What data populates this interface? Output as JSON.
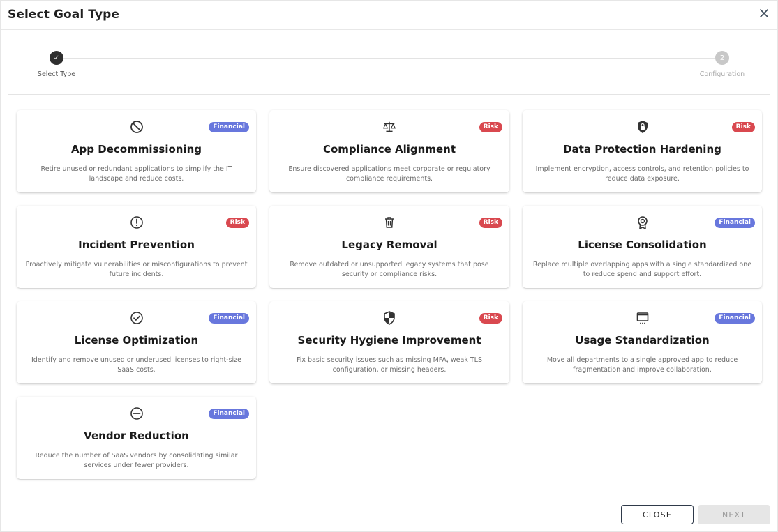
{
  "dialog": {
    "title": "Select Goal Type",
    "close_icon": "close-icon"
  },
  "stepper": {
    "steps": [
      {
        "label": "Select Type",
        "marker": "✓",
        "state": "completed"
      },
      {
        "label": "Configuration",
        "marker": "2",
        "state": "pending"
      }
    ]
  },
  "colors": {
    "financial_badge": "#6877dd",
    "risk_badge": "#d9484f",
    "completed_step": "#2f2f2f",
    "pending_step": "#c8c8c8"
  },
  "goal_types": [
    {
      "title": "App Decommissioning",
      "badge": "Financial",
      "icon": "ban-icon",
      "description": "Retire unused or redundant applications to simplify the IT landscape and reduce costs."
    },
    {
      "title": "Compliance Alignment",
      "badge": "Risk",
      "icon": "scale-icon",
      "description": "Ensure discovered applications meet corporate or regulatory compliance requirements."
    },
    {
      "title": "Data Protection Hardening",
      "badge": "Risk",
      "icon": "shield-lock-icon",
      "description": "Implement encryption, access controls, and retention policies to reduce data exposure."
    },
    {
      "title": "Incident Prevention",
      "badge": "Risk",
      "icon": "alert-circle-icon",
      "description": "Proactively mitigate vulnerabilities or misconfigurations to prevent future incidents."
    },
    {
      "title": "Legacy Removal",
      "badge": "Risk",
      "icon": "trash-icon",
      "description": "Remove outdated or unsupported legacy systems that pose security or compliance risks."
    },
    {
      "title": "License Consolidation",
      "badge": "Financial",
      "icon": "award-icon",
      "description": "Replace multiple overlapping apps with a single standardized one to reduce spend and support effort."
    },
    {
      "title": "License Optimization",
      "badge": "Financial",
      "icon": "check-circle-icon",
      "description": "Identify and remove unused or underused licenses to right-size SaaS costs."
    },
    {
      "title": "Security Hygiene Improvement",
      "badge": "Risk",
      "icon": "shield-half-icon",
      "description": "Fix basic security issues such as missing MFA, weak TLS configuration, or missing headers."
    },
    {
      "title": "Usage Standardization",
      "badge": "Financial",
      "icon": "monitor-icon",
      "description": "Move all departments to a single approved app to reduce fragmentation and improve collaboration."
    },
    {
      "title": "Vendor Reduction",
      "badge": "Financial",
      "icon": "minus-circle-icon",
      "description": "Reduce the number of SaaS vendors by consolidating similar services under fewer providers."
    }
  ],
  "footer": {
    "close_label": "CLOSE",
    "next_label": "NEXT"
  }
}
